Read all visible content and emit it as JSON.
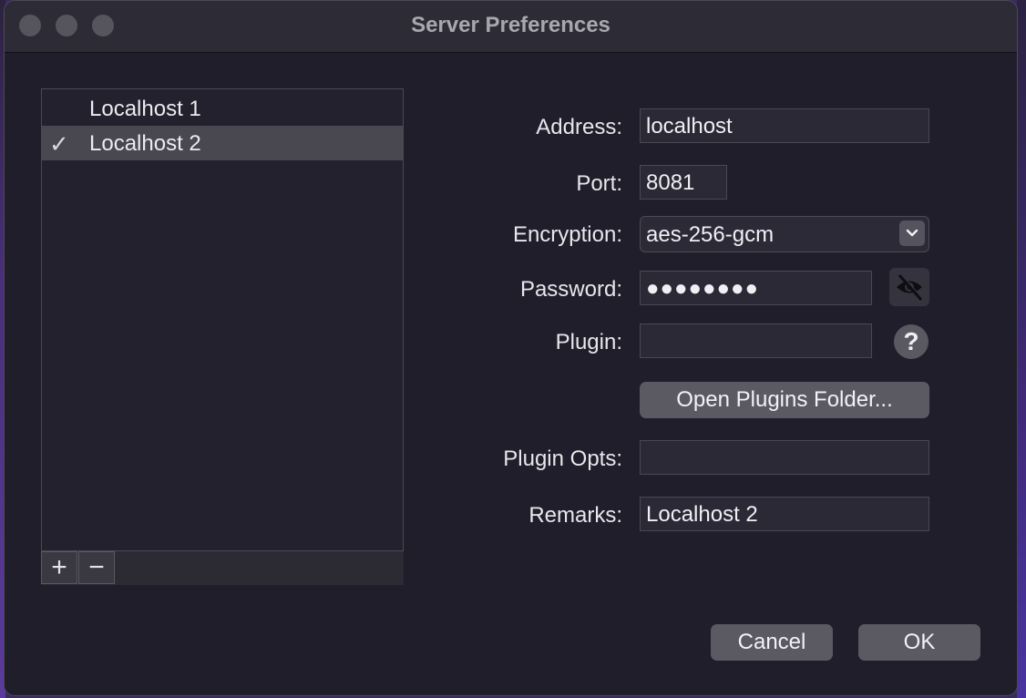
{
  "window": {
    "title": "Server Preferences"
  },
  "server_list": {
    "items": [
      {
        "label": "Localhost 1",
        "selected": false
      },
      {
        "label": "Localhost 2",
        "selected": true
      }
    ],
    "selected_mark": "✓",
    "add_label": "+",
    "remove_label": "−"
  },
  "form": {
    "address_label": "Address:",
    "address_value": "localhost",
    "port_label": "Port:",
    "port_value": "8081",
    "encryption_label": "Encryption:",
    "encryption_value": "aes-256-gcm",
    "password_label": "Password:",
    "password_value": "●●●●●●●●",
    "plugin_label": "Plugin:",
    "plugin_value": "",
    "help_label": "?",
    "open_plugins_label": "Open Plugins Folder...",
    "plugin_opts_label": "Plugin Opts:",
    "plugin_opts_value": "",
    "remarks_label": "Remarks:",
    "remarks_value": "Localhost 2"
  },
  "footer": {
    "cancel_label": "Cancel",
    "ok_label": "OK"
  },
  "icons": {
    "close": "traffic-light-close",
    "minimize": "traffic-light-minimize",
    "zoom": "traffic-light-zoom",
    "dropdown": "chevron-down-icon",
    "toggle_password": "eye-slash-icon",
    "help": "help-icon"
  }
}
